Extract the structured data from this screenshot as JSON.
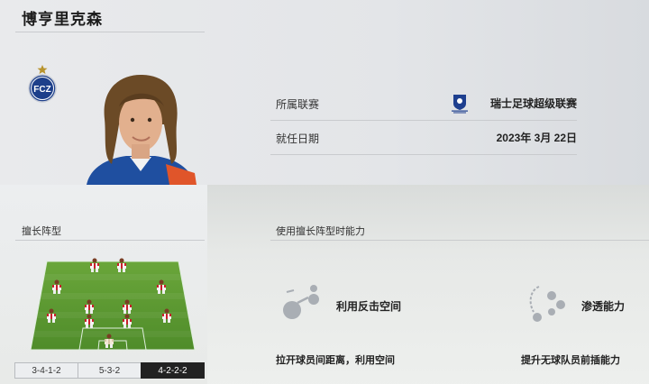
{
  "coach": {
    "name": "博亨里克森"
  },
  "info": {
    "league_label": "所属联赛",
    "league_value": "瑞士足球超级联赛",
    "date_label": "就任日期",
    "date_value": "2023年 3月 22日"
  },
  "club": {
    "badge_text": "FCZ"
  },
  "sections": {
    "formation_title": "擅长阵型",
    "ability_title": "使用擅长阵型时能力"
  },
  "formations": {
    "tabs": [
      "3-4-1-2",
      "5-3-2",
      "4-2-2-2"
    ],
    "selected": "4-2-2-2"
  },
  "abilities": [
    {
      "name": "利用反击空间",
      "desc": "拉开球员间距离，利用空间",
      "icon": "counter-space-icon"
    },
    {
      "name": "渗透能力",
      "desc": "提升无球队员前插能力",
      "icon": "penetration-icon"
    }
  ],
  "colors": {
    "pitch": "#5c9a34",
    "accent_dark": "#222222",
    "kit_red": "#c8202a"
  }
}
